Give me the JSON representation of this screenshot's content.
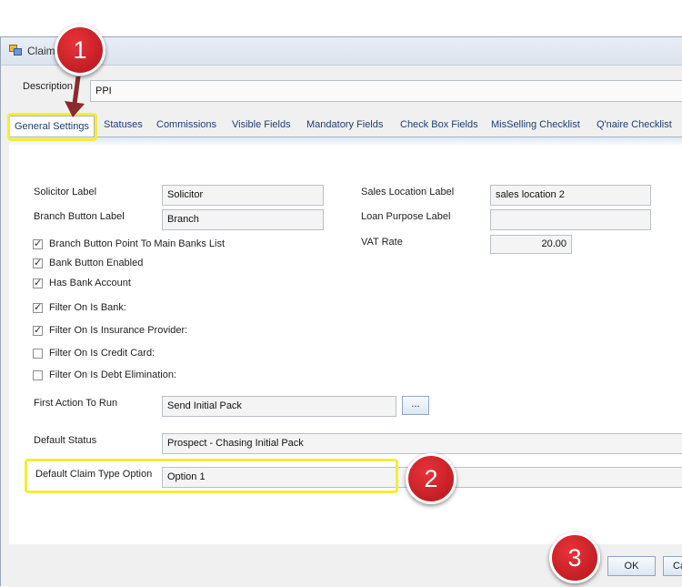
{
  "window": {
    "title": "Claim"
  },
  "header": {
    "description_label": "Description",
    "description_value": "PPI"
  },
  "tabs": [
    {
      "label": "General Settings",
      "active": true
    },
    {
      "label": "Statuses"
    },
    {
      "label": "Commissions"
    },
    {
      "label": "Visible Fields"
    },
    {
      "label": "Mandatory Fields"
    },
    {
      "label": "Check Box Fields"
    },
    {
      "label": "MisSelling Checklist"
    },
    {
      "label": "Q'naire Checklist"
    }
  ],
  "general": {
    "solicitor_label": {
      "label": "Solicitor Label",
      "value": "Solicitor"
    },
    "branch_button_label": {
      "label": "Branch Button Label",
      "value": "Branch"
    },
    "sales_location_label": {
      "label": "Sales Location Label",
      "value": "sales location 2"
    },
    "loan_purpose_label": {
      "label": "Loan Purpose Label",
      "value": ""
    },
    "vat_rate": {
      "label": "VAT Rate",
      "value": "20.00"
    },
    "checkboxes": [
      {
        "label": "Branch Button Point To Main Banks List",
        "checked": true
      },
      {
        "label": "Bank Button Enabled",
        "checked": true
      },
      {
        "label": "Has Bank Account",
        "checked": true
      },
      {
        "label": "Filter On Is Bank:",
        "checked": true
      },
      {
        "label": "Filter On Is Insurance Provider:",
        "checked": true
      },
      {
        "label": "Filter On Is Credit Card:",
        "checked": false
      },
      {
        "label": "Filter On Is Debt Elimination:",
        "checked": false
      }
    ],
    "check_glyph": "✓",
    "first_action": {
      "label": "First Action To Run",
      "value": "Send Initial Pack",
      "browse_label": "..."
    },
    "default_status": {
      "label": "Default Status",
      "value": "Prospect - Chasing Initial Pack"
    },
    "default_claim_type": {
      "label": "Default Claim Type Option",
      "value": "Option 1"
    }
  },
  "footer": {
    "ok_label": "OK",
    "cancel_label": "Ca"
  },
  "annotations": {
    "highlight_color": "#f2ee3a",
    "badge_color": "#c8191f",
    "arrow_color": "#8b2b2b",
    "badges": [
      "1",
      "2",
      "3"
    ]
  }
}
